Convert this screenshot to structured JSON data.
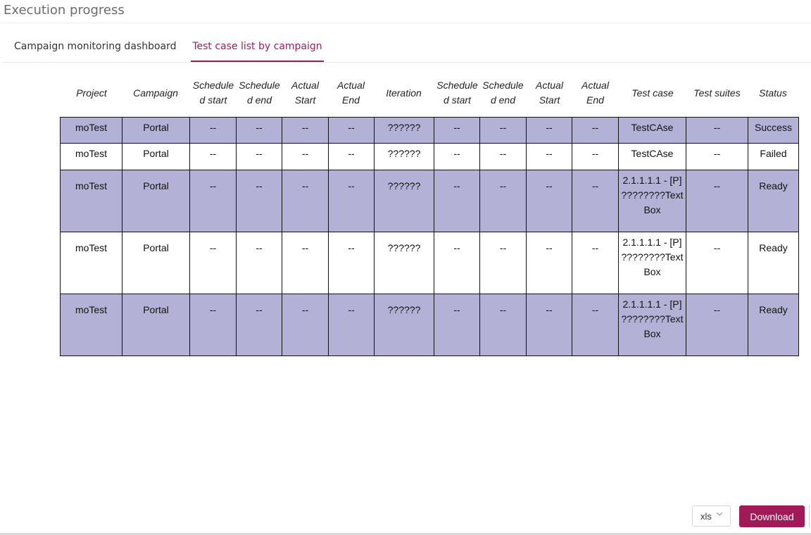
{
  "page": {
    "title": "Execution progress"
  },
  "tabs": [
    {
      "label": "Campaign monitoring dashboard",
      "active": false
    },
    {
      "label": "Test case list by campaign",
      "active": true
    }
  ],
  "table": {
    "headers": [
      "Project",
      "Campaign",
      "Schedule d start",
      "Schedule d end",
      "Actual Start",
      "Actual End",
      "Iteration",
      "Schedule d start",
      "Schedule d end",
      "Actual Start",
      "Actual End",
      "Test case",
      "Test suites",
      "Status"
    ],
    "rows": [
      [
        "moTest",
        "Portal",
        "--",
        "--",
        "--",
        "--",
        "??????",
        "--",
        "--",
        "--",
        "--",
        "TestCAse",
        "--",
        "Success"
      ],
      [
        "moTest",
        "Portal",
        "--",
        "--",
        "--",
        "--",
        "??????",
        "--",
        "--",
        "--",
        "--",
        "TestCAse",
        "--",
        "Failed"
      ],
      [
        "moTest",
        "Portal",
        "--",
        "--",
        "--",
        "--",
        "??????",
        "--",
        "--",
        "--",
        "--",
        "2.1.1.1.1 - [P] ????????Text Box",
        "--",
        "Ready"
      ],
      [
        "moTest",
        "Portal",
        "--",
        "--",
        "--",
        "--",
        "??????",
        "--",
        "--",
        "--",
        "--",
        "2.1.1.1.1 - [P] ????????Text Box",
        "--",
        "Ready"
      ],
      [
        "moTest",
        "Portal",
        "--",
        "--",
        "--",
        "--",
        "??????",
        "--",
        "--",
        "--",
        "--",
        "2.1.1.1.1 - [P] ????????Text Box",
        "--",
        "Ready"
      ]
    ],
    "row_shading": [
      "#b3b1d6",
      "#ffffff",
      "#b3b1d6",
      "#ffffff",
      "#b3b1d6"
    ]
  },
  "export": {
    "format_value": "xls",
    "download_label": "Download"
  },
  "colors": {
    "accent": "#9b1e5d",
    "button": "#a01a57",
    "row_shade": "#b3b1d6"
  }
}
